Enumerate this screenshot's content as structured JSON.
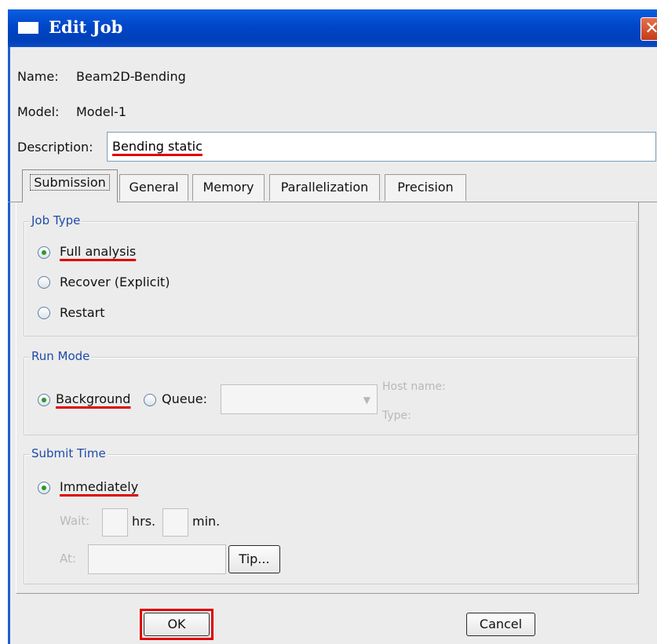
{
  "window": {
    "title": "Edit Job",
    "close_glyph": "✕"
  },
  "job": {
    "name_label": "Name:",
    "name_value": "Beam2D-Bending",
    "model_label": "Model:",
    "model_value": "Model-1",
    "description_label": "Description:",
    "description_value": "Bending static"
  },
  "tabs": [
    {
      "label": "Submission",
      "active": true
    },
    {
      "label": "General"
    },
    {
      "label": "Memory"
    },
    {
      "label": "Parallelization"
    },
    {
      "label": "Precision"
    }
  ],
  "job_type": {
    "title": "Job Type",
    "options": [
      {
        "label": "Full analysis",
        "selected": true
      },
      {
        "label": "Recover (Explicit)",
        "selected": false
      },
      {
        "label": "Restart",
        "selected": false
      }
    ]
  },
  "run_mode": {
    "title": "Run Mode",
    "background_label": "Background",
    "background_selected": true,
    "queue_label": "Queue:",
    "queue_selected": false,
    "host_name_label": "Host name:",
    "type_label": "Type:"
  },
  "submit_time": {
    "title": "Submit Time",
    "immediately_label": "Immediately",
    "immediately_selected": true,
    "wait_label": "Wait:",
    "hrs_label": "hrs.",
    "min_label": "min.",
    "at_label": "At:",
    "tip_label": "Tip..."
  },
  "buttons": {
    "ok": "OK",
    "cancel": "Cancel"
  },
  "colors": {
    "titlebar": "#0046c8",
    "highlight": "#e00000",
    "group_title": "#1f4ba8"
  },
  "icons": {
    "title": "window-icon",
    "close": "close-icon",
    "combo": "dropdown-arrow-icon"
  }
}
